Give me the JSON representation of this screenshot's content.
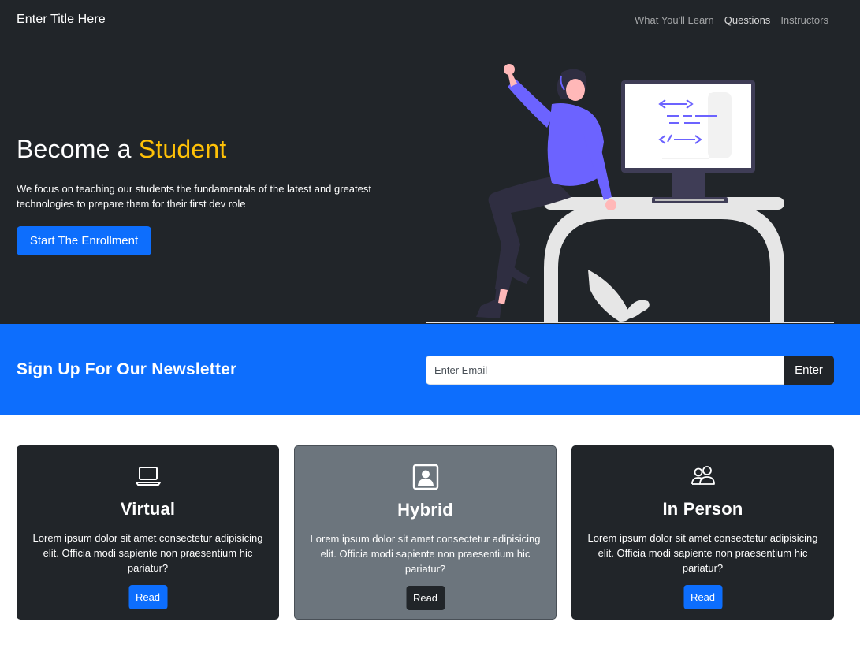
{
  "navbar": {
    "brand": "Enter Title Here",
    "links": [
      "What You'll Learn",
      "Questions",
      "Instructors"
    ]
  },
  "hero": {
    "title_prefix": "Become a ",
    "title_accent": "Student",
    "description": "We focus on teaching our students the fundamentals of the latest and greatest technologies to prepare them for their first dev role",
    "cta_label": "Start The Enrollment",
    "illustration": "person-sitting-on-desk-with-code-monitor"
  },
  "newsletter": {
    "title": "Sign Up For Our Newsletter",
    "email_placeholder": "Enter Email",
    "email_value": "",
    "button_label": "Enter"
  },
  "cards": [
    {
      "icon": "laptop-icon",
      "title": "Virtual",
      "text": "Lorem ipsum dolor sit amet consectetur adipisicing elit. Officia modi sapiente non praesentium hic pariatur?",
      "button_label": "Read"
    },
    {
      "icon": "person-badge-icon",
      "title": "Hybrid",
      "text": "Lorem ipsum dolor sit amet consectetur adipisicing elit. Officia modi sapiente non praesentium hic pariatur?",
      "button_label": "Read"
    },
    {
      "icon": "people-icon",
      "title": "In Person",
      "text": "Lorem ipsum dolor sit amet consectetur adipisicing elit. Officia modi sapiente non praesentium hic pariatur?",
      "button_label": "Read"
    }
  ],
  "colors": {
    "dark": "#212529",
    "primary": "#0d6efd",
    "accent": "#ffc107",
    "secondary": "#6c757d",
    "illustration_purple": "#6c63ff"
  }
}
